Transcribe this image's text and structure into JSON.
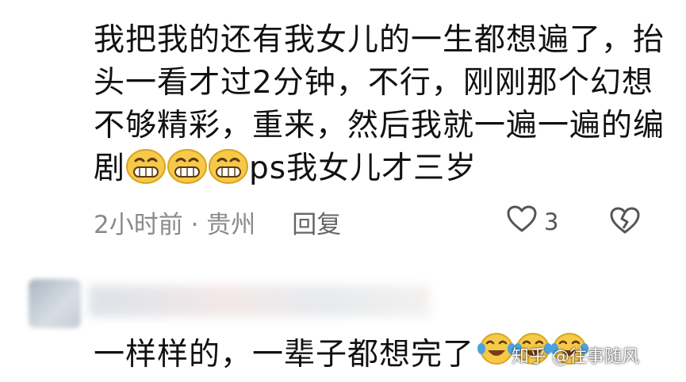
{
  "comment": {
    "text": "我把我的还有我女儿的一生都想遍了，抬头一看才过2分钟，不行，刚刚那个幻想不够精彩，重来，然后我就一遍一遍的编剧",
    "text_after_emojis": "ps我女儿才三岁",
    "emoji_icons": [
      "grin-emoji-icon",
      "grin-emoji-icon",
      "grin-emoji-icon"
    ],
    "meta": "2小时前 · 贵州",
    "reply_label": "回复",
    "like_count": "3"
  },
  "reply": {
    "text": "一样样的，一辈子都想完了",
    "emoji_icons": [
      "tears-of-joy-emoji-icon",
      "tears-of-joy-emoji-icon",
      "tears-of-joy-emoji-icon"
    ]
  },
  "watermark": "知乎 @往事随风",
  "colors": {
    "text": "#111111",
    "meta": "#8a8a8a",
    "emoji_yellow": "#f7c948"
  }
}
